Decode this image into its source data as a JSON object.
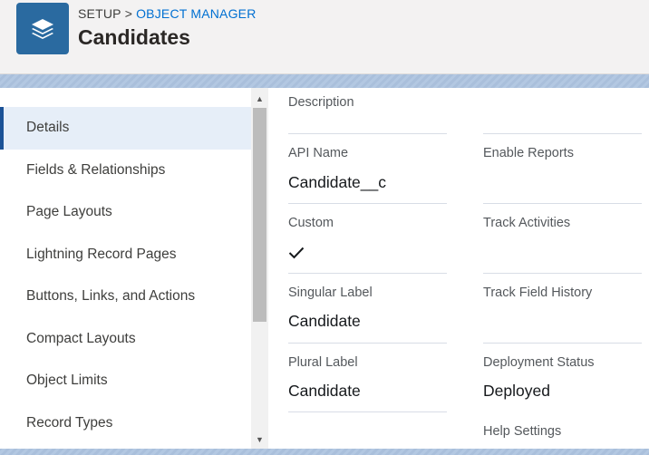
{
  "header": {
    "breadcrumb_root": "SETUP",
    "breadcrumb_sep": ">",
    "breadcrumb_link": "OBJECT MANAGER",
    "title": "Candidates",
    "icon": "layers-icon"
  },
  "sidebar": {
    "items": [
      {
        "label": "Details",
        "active": true
      },
      {
        "label": "Fields & Relationships"
      },
      {
        "label": "Page Layouts"
      },
      {
        "label": "Lightning Record Pages"
      },
      {
        "label": "Buttons, Links, and Actions"
      },
      {
        "label": "Compact Layouts"
      },
      {
        "label": "Object Limits"
      },
      {
        "label": "Record Types"
      }
    ]
  },
  "details": {
    "description_label": "Description",
    "api_name_label": "API Name",
    "api_name_value": "Candidate__c",
    "enable_reports_label": "Enable Reports",
    "custom_label": "Custom",
    "track_activities_label": "Track Activities",
    "singular_label_label": "Singular Label",
    "singular_label_value": "Candidate",
    "track_field_history_label": "Track Field History",
    "plural_label_label": "Plural Label",
    "plural_label_value": "Candidate",
    "deployment_status_label": "Deployment Status",
    "deployment_status_value": "Deployed",
    "help_settings_label": "Help Settings"
  },
  "colors": {
    "accent": "#0070d2",
    "icon_bg": "#2a6aa0",
    "active_nav_border": "#1b5297"
  }
}
